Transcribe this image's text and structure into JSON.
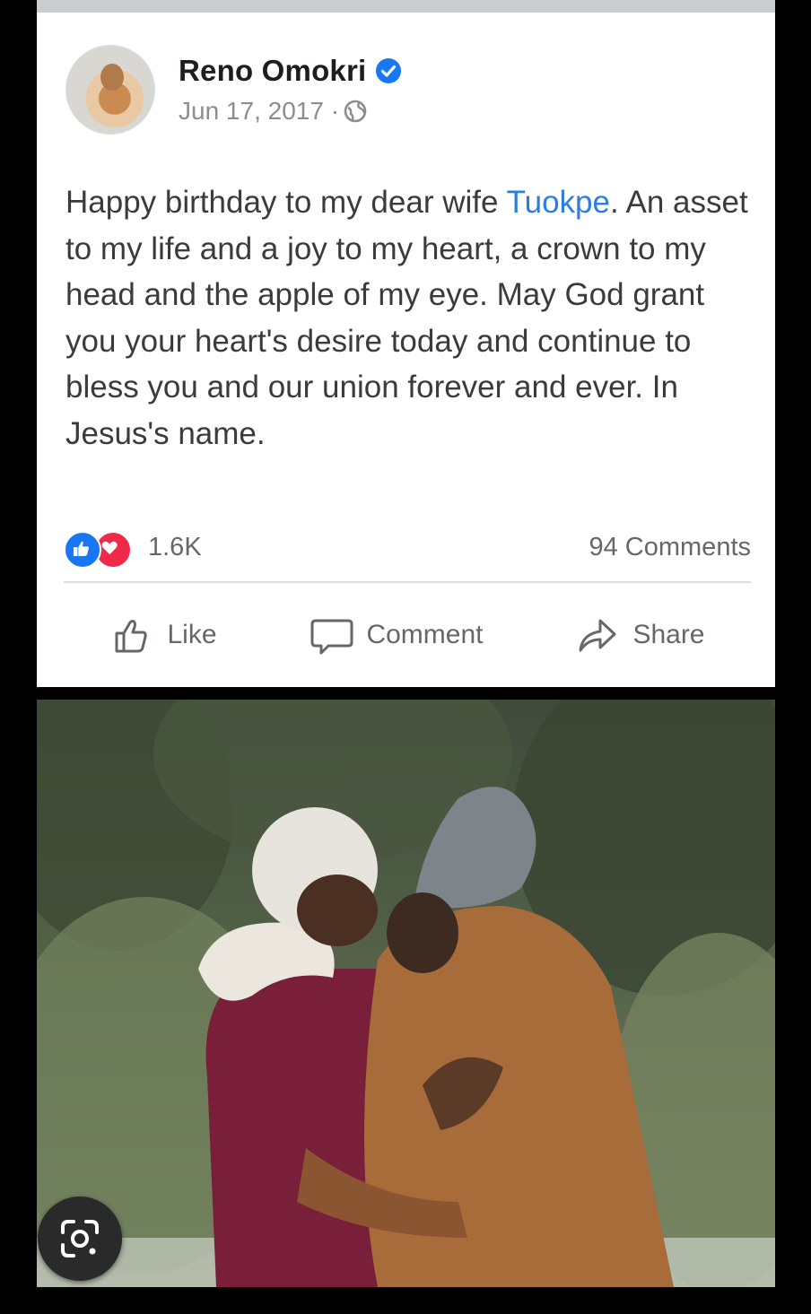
{
  "post": {
    "author": "Reno Omokri",
    "date": "Jun 17, 2017 ·",
    "text_before": "Happy birthday to my dear wife ",
    "mention": "Tuokpe",
    "text_after": ". An asset to my life and a joy to my heart, a crown to my head and the apple of my eye. May God grant you your heart's desire today and continue to bless you and our union forever and ever. In Jesus's name.",
    "reaction_count": "1.6K",
    "comments_count": "94 Comments",
    "actions": {
      "like": "Like",
      "comment": "Comment",
      "share": "Share"
    }
  },
  "icons": {
    "verified": "verified-badge-icon",
    "privacy": "globe-icon",
    "like_react": "thumbs-up-reaction-icon",
    "love_react": "heart-reaction-icon",
    "lens": "google-lens-icon"
  },
  "colors": {
    "accent": "#1877f2",
    "mention": "#2d7de0",
    "love": "#f02849"
  }
}
